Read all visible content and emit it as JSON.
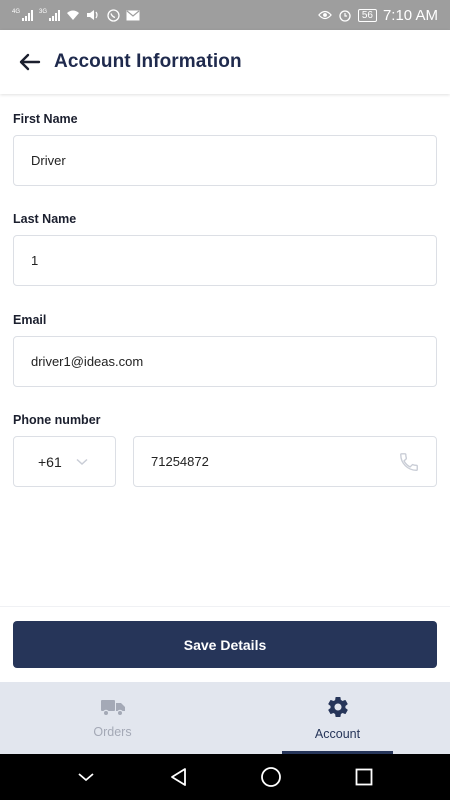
{
  "status_bar": {
    "network_1": "4G",
    "network_2": "3G",
    "battery": "56",
    "time": "7:10 AM"
  },
  "header": {
    "title": "Account Information",
    "back_icon": "arrow-left-icon"
  },
  "form": {
    "first_name": {
      "label": "First Name",
      "value": "Driver"
    },
    "last_name": {
      "label": "Last Name",
      "value": "1"
    },
    "email": {
      "label": "Email",
      "value": "driver1@ideas.com"
    },
    "phone": {
      "label": "Phone number",
      "country_code": "+61",
      "number": "71254872",
      "icon": "phone-icon"
    }
  },
  "actions": {
    "save_label": "Save Details"
  },
  "bottom_nav": {
    "items": [
      {
        "label": "Orders",
        "icon": "truck-icon",
        "active": false
      },
      {
        "label": "Account",
        "icon": "gear-icon",
        "active": true
      }
    ]
  },
  "colors": {
    "primary": "#263559",
    "title": "#1f2a4d",
    "nav_background": "#e2e6ee",
    "status_bar": "#9e9e9e"
  }
}
